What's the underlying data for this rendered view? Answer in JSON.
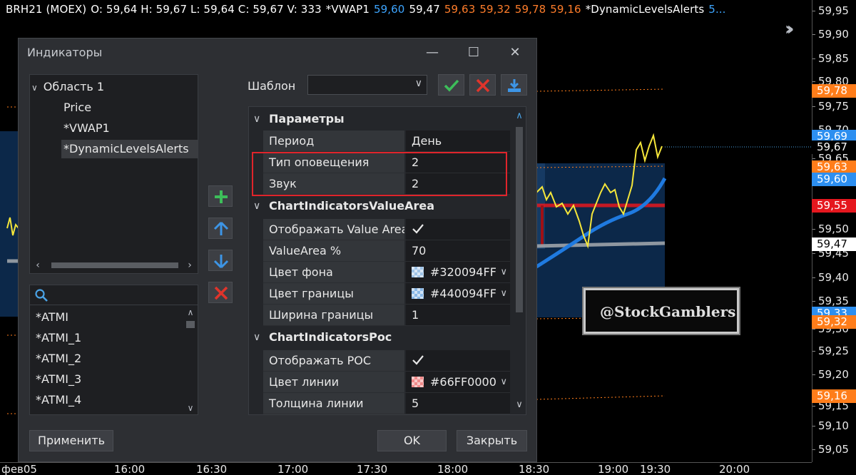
{
  "chart": {
    "header": {
      "symbol": "BRH21 (MOEX)",
      "ohlcv": "O: 59,64  H: 59,67  L: 59,64  C: 59,67  V: 333",
      "vwap_label": "*VWAP1",
      "vwap_val_1": "59,60",
      "vwap_val_2": "59,47",
      "vwap_val_3": "59,63",
      "vwap_val_4": "59,32",
      "vwap_val_5": "59,78",
      "vwap_val_6": "59,16",
      "dla_label": "*DynamicLevelsAlerts",
      "dla_val": "5..."
    },
    "price_ticks": [
      "59,95",
      "59,90",
      "59,85",
      "59,80",
      "59,75",
      "59,70",
      "59,65",
      "59,50",
      "59,45",
      "59,40",
      "59,35",
      "59,30",
      "59,25",
      "59,20",
      "59,15",
      "59,10",
      "59,05"
    ],
    "price_badges": [
      {
        "text": "59,78",
        "bg": "#ff7d1a",
        "fg": "#ffffff"
      },
      {
        "text": "59,69",
        "bg": "#2d8ff0",
        "fg": "#ffffff"
      },
      {
        "text": "59,67",
        "bg": "#000000",
        "fg": "#ffffff"
      },
      {
        "text": "59,63",
        "bg": "#ff7d1a",
        "fg": "#ffffff"
      },
      {
        "text": "59,60",
        "bg": "#2d8ff0",
        "fg": "#ffffff"
      },
      {
        "text": "59,55",
        "bg": "#e5171e",
        "fg": "#ffffff"
      },
      {
        "text": "59,47",
        "bg": "#ffffff",
        "fg": "#000000"
      },
      {
        "text": "59,33",
        "bg": "#2d8ff0",
        "fg": "#ffffff"
      },
      {
        "text": "59,32",
        "bg": "#ff7d1a",
        "fg": "#ffffff"
      },
      {
        "text": "59,16",
        "bg": "#ff7d1a",
        "fg": "#ffffff"
      }
    ],
    "time_ticks": [
      "фев05",
      "16:00",
      "16:30",
      "17:00",
      "17:30",
      "18:00",
      "18:30",
      "19:00",
      "19:30",
      "20:00"
    ],
    "watermark": "@StockGamblers"
  },
  "dialog": {
    "title": "Индикаторы",
    "tree": {
      "root": "Область 1",
      "children": [
        "Price",
        "*VWAP1",
        "*DynamicLevelsAlerts"
      ]
    },
    "search_placeholder": "",
    "indicator_list": [
      "*ATMI",
      "*ATMI_1",
      "*ATMI_2",
      "*ATMI_3",
      "*ATMI_4"
    ],
    "template_label": "Шаблон",
    "template_value": "",
    "groups": {
      "params": "Параметры",
      "value_area": "ChartIndicatorsValueArea",
      "poc": "ChartIndicatorsPoc"
    },
    "props": {
      "period": {
        "name": "Период",
        "value": "День"
      },
      "alert_type": {
        "name": "Тип оповещения",
        "value": "2"
      },
      "sound": {
        "name": "Звук",
        "value": "2"
      },
      "show_va": {
        "name": "Отображать Value Area",
        "value": ""
      },
      "va_pct": {
        "name": "ValueArea %",
        "value": "70"
      },
      "bg_color": {
        "name": "Цвет фона",
        "value": "#320094FF"
      },
      "border_color": {
        "name": "Цвет границы",
        "value": "#440094FF"
      },
      "border_width": {
        "name": "Ширина границы",
        "value": "1"
      },
      "show_poc": {
        "name": "Отображать POC",
        "value": ""
      },
      "line_color": {
        "name": "Цвет линии",
        "value": "#66FF0000"
      },
      "line_width": {
        "name": "Толщина линии",
        "value": "5"
      }
    },
    "buttons": {
      "apply": "Применить",
      "ok": "OK",
      "close": "Закрыть"
    },
    "colors": {
      "add": "#3dbe5a",
      "move": "#3d95e6",
      "remove": "#e0342b",
      "highlight": "#e0242b"
    }
  }
}
